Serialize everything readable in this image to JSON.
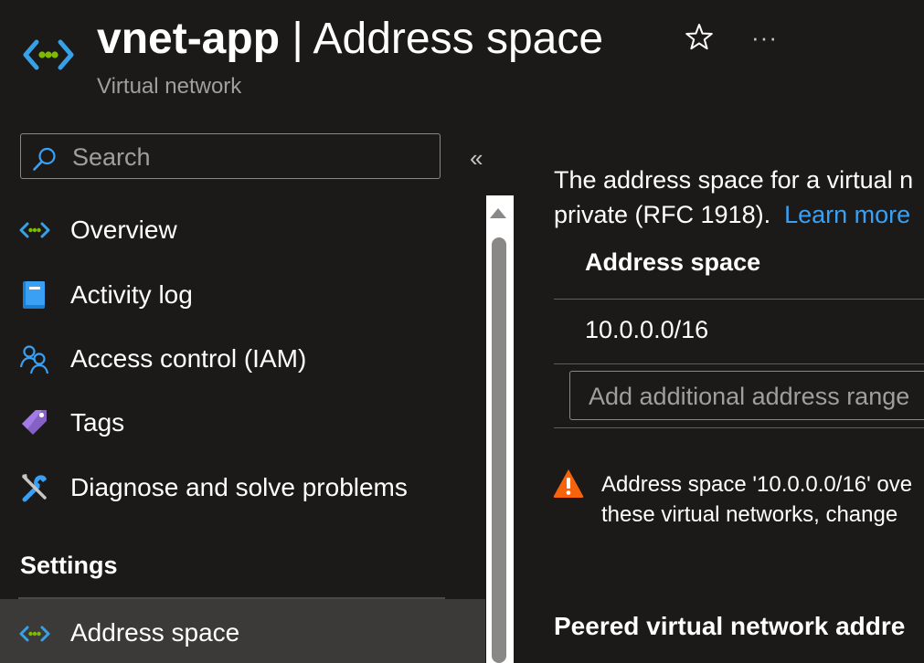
{
  "header": {
    "resource_name": "vnet-app",
    "separator": "|",
    "blade_title": "Address space",
    "resource_type": "Virtual network",
    "favorite_icon": "star-outline-icon",
    "more_icon": "ellipsis-icon",
    "more_label": "···"
  },
  "sidebar": {
    "search_placeholder": "Search",
    "collapse_label": "«",
    "items": [
      {
        "label": "Overview",
        "icon": "vnet-icon"
      },
      {
        "label": "Activity log",
        "icon": "activity-log-icon"
      },
      {
        "label": "Access control (IAM)",
        "icon": "people-icon"
      },
      {
        "label": "Tags",
        "icon": "tag-icon"
      },
      {
        "label": "Diagnose and solve problems",
        "icon": "wrench-icon"
      }
    ],
    "settings_heading": "Settings",
    "settings_items": [
      {
        "label": "Address space",
        "icon": "vnet-icon",
        "active": true
      }
    ]
  },
  "main": {
    "description_line1": "The address space for a virtual n",
    "description_line2": "private (RFC 1918).",
    "learn_more": "Learn more",
    "column_header": "Address space",
    "address_spaces": [
      "10.0.0.0/16"
    ],
    "add_placeholder": "Add additional address range",
    "warning_line1": "Address space '10.0.0.0/16' ove",
    "warning_line2": "these virtual networks, change",
    "peered_heading": "Peered virtual network addre"
  },
  "colors": {
    "background": "#1b1a19",
    "link": "#3aa0f3",
    "warning": "#f7630c",
    "active_item": "#3b3a39",
    "muted_text": "#a19f9d"
  }
}
